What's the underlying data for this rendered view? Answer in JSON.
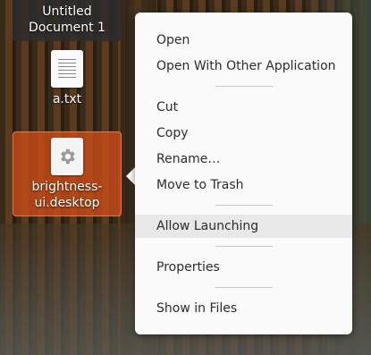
{
  "desktop": {
    "icons": [
      {
        "label_line1": "Untitled",
        "label_line2": "Document 1",
        "icon": "document-icon"
      },
      {
        "label": "a.txt",
        "icon": "text-file-icon"
      },
      {
        "label_line1": "brightness-",
        "label_line2": "ui.desktop",
        "icon": "gear-icon",
        "selected": true
      }
    ]
  },
  "context_menu": {
    "items": [
      {
        "label": "Open"
      },
      {
        "label": "Open With Other Application"
      },
      {
        "label": "Cut"
      },
      {
        "label": "Copy"
      },
      {
        "label": "Rename…"
      },
      {
        "label": "Move to Trash"
      },
      {
        "label": "Allow Launching",
        "highlighted": true
      },
      {
        "label": "Properties"
      },
      {
        "label": "Show in Files"
      }
    ]
  },
  "colors": {
    "selection": "#c74c19",
    "menu_bg": "#fafafa",
    "menu_hover": "#e8e8e8",
    "menu_text": "#2c2c2c"
  }
}
